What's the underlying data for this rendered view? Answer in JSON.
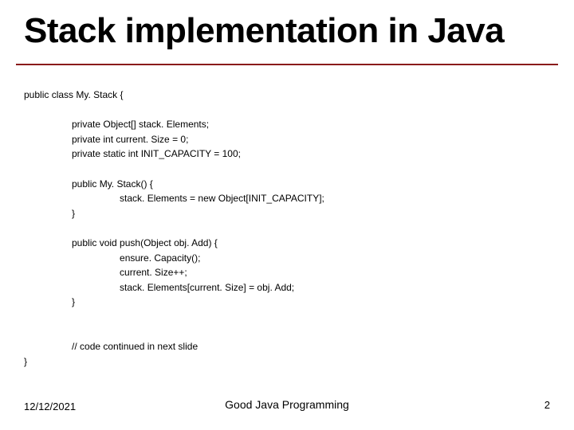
{
  "title": "Stack implementation in Java",
  "code": "public class My. Stack {\n\n                  private Object[] stack. Elements;\n                  private int current. Size = 0;\n                  private static int INIT_CAPACITY = 100;\n\n                  public My. Stack() {\n                                    stack. Elements = new Object[INIT_CAPACITY];\n                  }\n\n                  public void push(Object obj. Add) {\n                                    ensure. Capacity();\n                                    current. Size++;\n                                    stack. Elements[current. Size] = obj. Add;\n                  }\n\n\n                  // code continued in next slide\n}",
  "footer": {
    "date": "12/12/2021",
    "center": "Good Java Programming",
    "page": "2"
  }
}
